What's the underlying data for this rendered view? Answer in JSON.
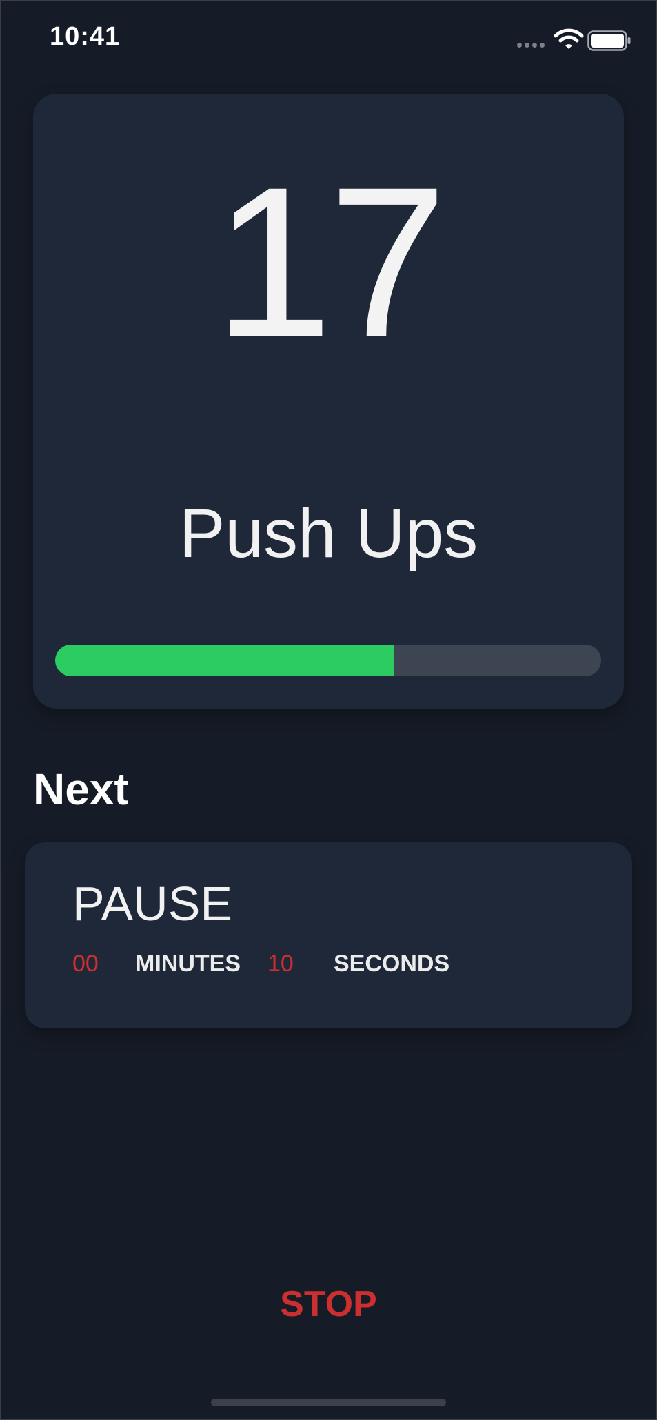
{
  "status_bar": {
    "time": "10:41",
    "icons": [
      "signal-dots-icon",
      "wifi-icon",
      "battery-icon"
    ]
  },
  "exercise": {
    "rep_count": "17",
    "name": "Push Ups",
    "progress": 0.62
  },
  "next": {
    "heading": "Next",
    "title": "PAUSE",
    "minutes_value": "00",
    "minutes_label": "MINUTES",
    "seconds_value": "10",
    "seconds_label": "SECONDS"
  },
  "actions": {
    "stop_label": "STOP"
  },
  "colors": {
    "background": "#161c27",
    "card": "#1e2838",
    "progress": "#2dcc63",
    "accent_red": "#cc2f2f"
  }
}
